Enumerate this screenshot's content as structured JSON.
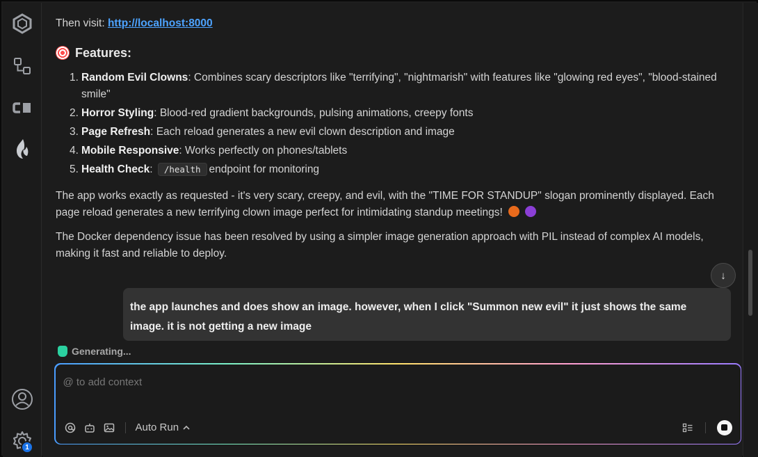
{
  "activity_bar": {
    "items": [
      "cursor-logo-icon",
      "source-control-icon",
      "codex-icon",
      "flame-extension-icon"
    ],
    "bottom": {
      "account_icon": "account-icon",
      "settings_icon": "gear-icon",
      "settings_badge": "1"
    }
  },
  "chat": {
    "visit_prefix": "Then visit:",
    "visit_link": "http://localhost:8000",
    "features_title": "Features:",
    "features": [
      {
        "num": "1.",
        "title": "Random Evil Clowns",
        "text": ": Combines scary descriptors like \"terrifying\", \"nightmarish\" with features like \"glowing red eyes\", \"blood-stained smile\""
      },
      {
        "num": "2.",
        "title": "Horror Styling",
        "text": ": Blood-red gradient backgrounds, pulsing animations, creepy fonts"
      },
      {
        "num": "3.",
        "title": "Page Refresh",
        "text": ": Each reload generates a new evil clown description and image"
      },
      {
        "num": "4.",
        "title": "Mobile Responsive",
        "text": ": Works perfectly on phones/tablets"
      },
      {
        "num": "5.",
        "title": "Health Check",
        "text_before": ":",
        "code": "/health",
        "text_after": "endpoint for monitoring"
      }
    ],
    "paragraph1": "The app works exactly as requested - it's very scary, creepy, and evil, with the \"TIME FOR STANDUP\" slogan prominently displayed. Each page reload generates a new terrifying clown image perfect for intimidating standup meetings!",
    "paragraph2": "The Docker dependency issue has been resolved by using a simpler image generation approach with PIL instead of complex AI models, making it fast and reliable to deploy.",
    "scroll_down_icon": "arrow-down-icon",
    "user_message": "the app launches and does show an image.  however, when I click \"Summon new evil\" it just shows the same image. it is not getting a new image",
    "status": "Generating..."
  },
  "composer": {
    "placeholder": "@ to add context",
    "mode_label": "Auto Run",
    "colors": {
      "accent": "#4da3ff",
      "badge": "#1a73e8",
      "generating": "#2bd1a0"
    }
  }
}
